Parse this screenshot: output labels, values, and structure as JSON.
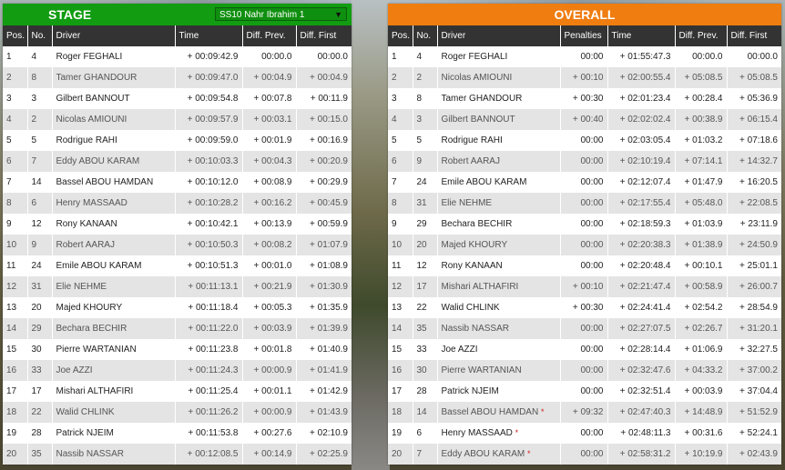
{
  "stage": {
    "title": "STAGE",
    "stage_select": "SS10 Nahr Ibrahim 1",
    "columns": [
      "Pos.",
      "No.",
      "Driver",
      "Time",
      "Diff. Prev.",
      "Diff. First"
    ],
    "rows": [
      {
        "pos": "1",
        "no": "4",
        "driver": "Roger FEGHALI",
        "time": "+ 00:09:42.9",
        "prev": "00:00.0",
        "first": "00:00.0"
      },
      {
        "pos": "2",
        "no": "8",
        "driver": "Tamer GHANDOUR",
        "time": "+ 00:09:47.0",
        "prev": "+ 00:04.9",
        "first": "+ 00:04.9"
      },
      {
        "pos": "3",
        "no": "3",
        "driver": "Gilbert BANNOUT",
        "time": "+ 00:09:54.8",
        "prev": "+ 00:07.8",
        "first": "+ 00:11.9"
      },
      {
        "pos": "4",
        "no": "2",
        "driver": "Nicolas AMIOUNI",
        "time": "+ 00:09:57.9",
        "prev": "+ 00:03.1",
        "first": "+ 00:15.0"
      },
      {
        "pos": "5",
        "no": "5",
        "driver": "Rodrigue RAHI",
        "time": "+ 00:09:59.0",
        "prev": "+ 00:01.9",
        "first": "+ 00:16.9"
      },
      {
        "pos": "6",
        "no": "7",
        "driver": "Eddy ABOU KARAM",
        "time": "+ 00:10:03.3",
        "prev": "+ 00:04.3",
        "first": "+ 00:20.9"
      },
      {
        "pos": "7",
        "no": "14",
        "driver": "Bassel ABOU HAMDAN",
        "time": "+ 00:10:12.0",
        "prev": "+ 00:08.9",
        "first": "+ 00:29.9"
      },
      {
        "pos": "8",
        "no": "6",
        "driver": "Henry MASSAAD",
        "time": "+ 00:10:28.2",
        "prev": "+ 00:16.2",
        "first": "+ 00:45.9"
      },
      {
        "pos": "9",
        "no": "12",
        "driver": "Rony KANAAN",
        "time": "+ 00:10:42.1",
        "prev": "+ 00:13.9",
        "first": "+ 00:59.9"
      },
      {
        "pos": "10",
        "no": "9",
        "driver": "Robert AARAJ",
        "time": "+ 00:10:50.3",
        "prev": "+ 00:08.2",
        "first": "+ 01:07.9"
      },
      {
        "pos": "11",
        "no": "24",
        "driver": "Emile ABOU KARAM",
        "time": "+ 00:10:51.3",
        "prev": "+ 00:01.0",
        "first": "+ 01:08.9"
      },
      {
        "pos": "12",
        "no": "31",
        "driver": "Elie NEHME",
        "time": "+ 00:11:13.1",
        "prev": "+ 00:21.9",
        "first": "+ 01:30.9"
      },
      {
        "pos": "13",
        "no": "20",
        "driver": "Majed KHOURY",
        "time": "+ 00:11:18.4",
        "prev": "+ 00:05.3",
        "first": "+ 01:35.9"
      },
      {
        "pos": "14",
        "no": "29",
        "driver": "Bechara BECHIR",
        "time": "+ 00:11:22.0",
        "prev": "+ 00:03.9",
        "first": "+ 01:39.9"
      },
      {
        "pos": "15",
        "no": "30",
        "driver": "Pierre WARTANIAN",
        "time": "+ 00:11:23.8",
        "prev": "+ 00:01.8",
        "first": "+ 01:40.9"
      },
      {
        "pos": "16",
        "no": "33",
        "driver": "Joe AZZI",
        "time": "+ 00:11:24.3",
        "prev": "+ 00:00.9",
        "first": "+ 01:41.9"
      },
      {
        "pos": "17",
        "no": "17",
        "driver": "Mishari ALTHAFIRI",
        "time": "+ 00:11:25.4",
        "prev": "+ 00:01.1",
        "first": "+ 01:42.9"
      },
      {
        "pos": "18",
        "no": "22",
        "driver": "Walid CHLINK",
        "time": "+ 00:11:26.2",
        "prev": "+ 00:00.9",
        "first": "+ 01:43.9"
      },
      {
        "pos": "19",
        "no": "28",
        "driver": "Patrick NJEIM",
        "time": "+ 00:11:53.8",
        "prev": "+ 00:27.6",
        "first": "+ 02:10.9"
      },
      {
        "pos": "20",
        "no": "35",
        "driver": "Nassib NASSAR",
        "time": "+ 00:12:08.5",
        "prev": "+ 00:14.9",
        "first": "+ 02:25.9"
      }
    ]
  },
  "overall": {
    "title": "OVERALL",
    "columns": [
      "Pos.",
      "No.",
      "Driver",
      "Penalties",
      "Time",
      "Diff. Prev.",
      "Diff. First"
    ],
    "rows": [
      {
        "pos": "1",
        "no": "4",
        "driver": "Roger FEGHALI",
        "star": "",
        "pen": "00:00",
        "time": "+ 01:55:47.3",
        "prev": "00:00.0",
        "first": "00:00.0"
      },
      {
        "pos": "2",
        "no": "2",
        "driver": "Nicolas AMIOUNI",
        "star": "",
        "pen": "+ 00:10",
        "time": "+ 02:00:55.4",
        "prev": "+ 05:08.5",
        "first": "+ 05:08.5"
      },
      {
        "pos": "3",
        "no": "8",
        "driver": "Tamer GHANDOUR",
        "star": "",
        "pen": "+ 00:30",
        "time": "+ 02:01:23.4",
        "prev": "+ 00:28.4",
        "first": "+ 05:36.9"
      },
      {
        "pos": "4",
        "no": "3",
        "driver": "Gilbert BANNOUT",
        "star": "",
        "pen": "+ 00:40",
        "time": "+ 02:02:02.4",
        "prev": "+ 00:38.9",
        "first": "+ 06:15.4"
      },
      {
        "pos": "5",
        "no": "5",
        "driver": "Rodrigue RAHI",
        "star": "",
        "pen": "00:00",
        "time": "+ 02:03:05.4",
        "prev": "+ 01:03.2",
        "first": "+ 07:18.6"
      },
      {
        "pos": "6",
        "no": "9",
        "driver": "Robert AARAJ",
        "star": "",
        "pen": "00:00",
        "time": "+ 02:10:19.4",
        "prev": "+ 07:14.1",
        "first": "+ 14:32.7"
      },
      {
        "pos": "7",
        "no": "24",
        "driver": "Emile ABOU KARAM",
        "star": "",
        "pen": "00:00",
        "time": "+ 02:12:07.4",
        "prev": "+ 01:47.9",
        "first": "+ 16:20.5"
      },
      {
        "pos": "8",
        "no": "31",
        "driver": "Elie NEHME",
        "star": "",
        "pen": "00:00",
        "time": "+ 02:17:55.4",
        "prev": "+ 05:48.0",
        "first": "+ 22:08.5"
      },
      {
        "pos": "9",
        "no": "29",
        "driver": "Bechara BECHIR",
        "star": "",
        "pen": "00:00",
        "time": "+ 02:18:59.3",
        "prev": "+ 01:03.9",
        "first": "+ 23:11.9"
      },
      {
        "pos": "10",
        "no": "20",
        "driver": "Majed KHOURY",
        "star": "",
        "pen": "00:00",
        "time": "+ 02:20:38.3",
        "prev": "+ 01:38.9",
        "first": "+ 24:50.9"
      },
      {
        "pos": "11",
        "no": "12",
        "driver": "Rony KANAAN",
        "star": "",
        "pen": "00:00",
        "time": "+ 02:20:48.4",
        "prev": "+ 00:10.1",
        "first": "+ 25:01.1"
      },
      {
        "pos": "12",
        "no": "17",
        "driver": "Mishari ALTHAFIRI",
        "star": "",
        "pen": "+ 00:10",
        "time": "+ 02:21:47.4",
        "prev": "+ 00:58.9",
        "first": "+ 26:00.7"
      },
      {
        "pos": "13",
        "no": "22",
        "driver": "Walid CHLINK",
        "star": "",
        "pen": "+ 00:30",
        "time": "+ 02:24:41.4",
        "prev": "+ 02:54.2",
        "first": "+ 28:54.9"
      },
      {
        "pos": "14",
        "no": "35",
        "driver": "Nassib NASSAR",
        "star": "",
        "pen": "00:00",
        "time": "+ 02:27:07.5",
        "prev": "+ 02:26.7",
        "first": "+ 31:20.1"
      },
      {
        "pos": "15",
        "no": "33",
        "driver": "Joe AZZI",
        "star": "",
        "pen": "00:00",
        "time": "+ 02:28:14.4",
        "prev": "+ 01:06.9",
        "first": "+ 32:27.5"
      },
      {
        "pos": "16",
        "no": "30",
        "driver": "Pierre WARTANIAN",
        "star": "",
        "pen": "00:00",
        "time": "+ 02:32:47.6",
        "prev": "+ 04:33.2",
        "first": "+ 37:00.2"
      },
      {
        "pos": "17",
        "no": "28",
        "driver": "Patrick NJEIM",
        "star": "",
        "pen": "00:00",
        "time": "+ 02:32:51.4",
        "prev": "+ 00:03.9",
        "first": "+ 37:04.4"
      },
      {
        "pos": "18",
        "no": "14",
        "driver": "Bassel ABOU HAMDAN",
        "star": "*",
        "pen": "+ 09:32",
        "time": "+ 02:47:40.3",
        "prev": "+ 14:48.9",
        "first": "+ 51:52.9"
      },
      {
        "pos": "19",
        "no": "6",
        "driver": "Henry MASSAAD",
        "star": "*",
        "pen": "00:00",
        "time": "+ 02:48:11.3",
        "prev": "+ 00:31.6",
        "first": "+ 52:24.1"
      },
      {
        "pos": "20",
        "no": "7",
        "driver": "Eddy ABOU KARAM",
        "star": "*",
        "pen": "00:00",
        "time": "+ 02:58:31.2",
        "prev": "+ 10:19.9",
        "first": "+ 02:43.9"
      }
    ]
  }
}
